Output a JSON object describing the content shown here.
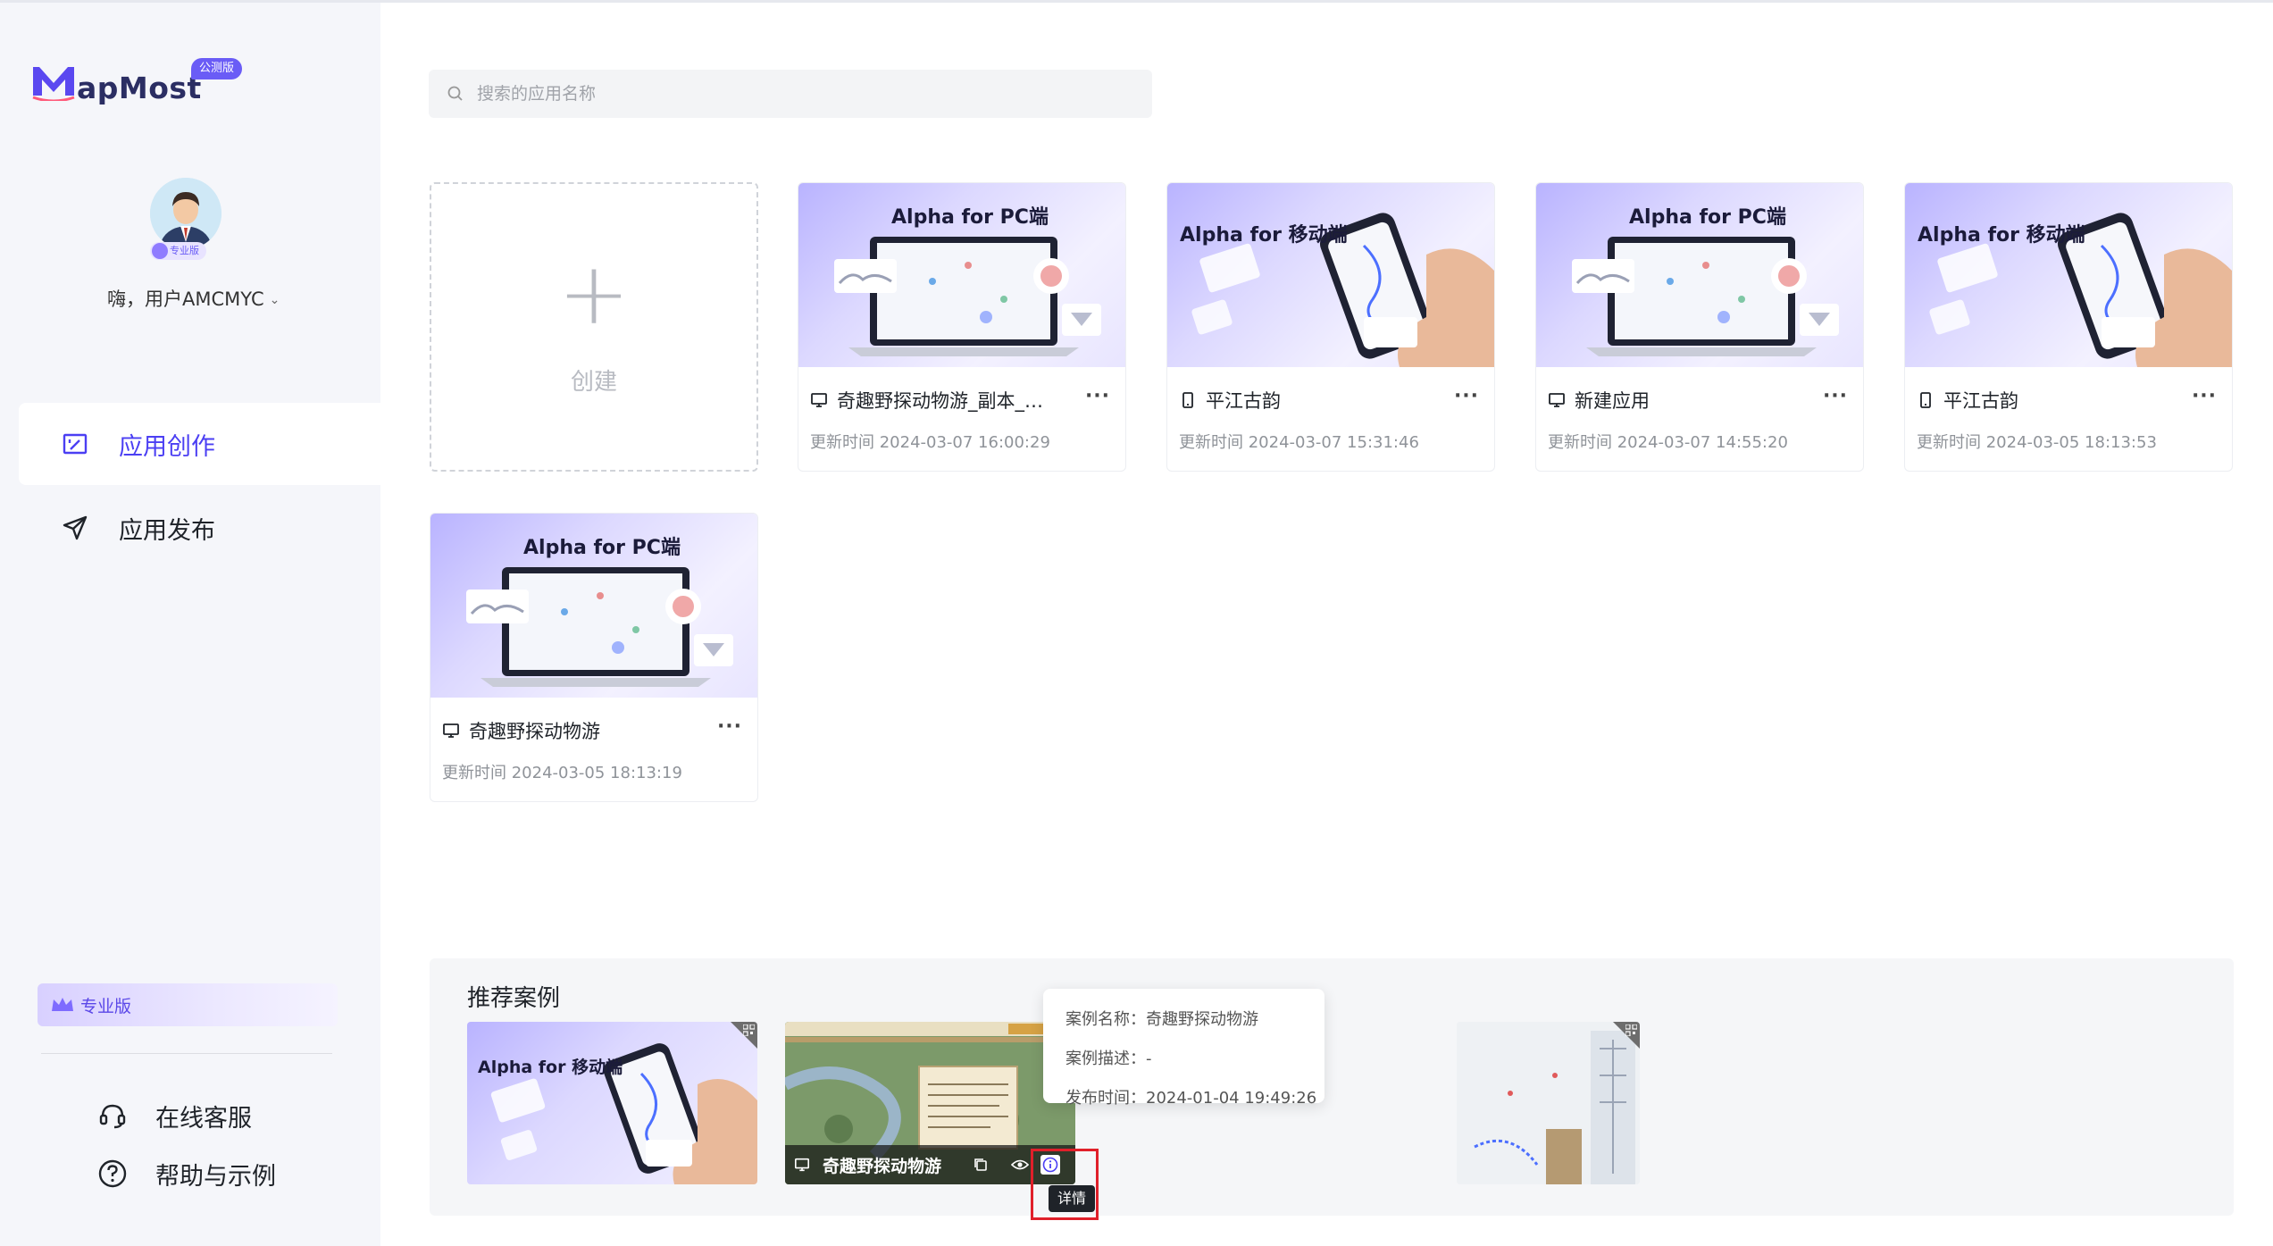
{
  "brand": {
    "logo_text": "apMost",
    "badge": "公测版"
  },
  "user": {
    "greeting": "嗨，用户AMCMYC",
    "plan_tag": "专业版"
  },
  "nav": {
    "create": "应用创作",
    "publish": "应用发布"
  },
  "sidebar_footer": {
    "pro_label": "专业版",
    "service": "在线客服",
    "help": "帮助与示例"
  },
  "search": {
    "placeholder": "搜索的应用名称"
  },
  "create_card": {
    "label": "创建"
  },
  "apps": [
    {
      "thumb_title": "Alpha for PC端",
      "type": "pc",
      "name": "奇趣野探动物游_副本_…",
      "time": "更新时间 2024-03-07 16:00:29"
    },
    {
      "thumb_title": "Alpha for 移动端",
      "type": "mobile",
      "name": "平江古韵",
      "time": "更新时间 2024-03-07 15:31:46"
    },
    {
      "thumb_title": "Alpha for PC端",
      "type": "pc",
      "name": "新建应用",
      "time": "更新时间 2024-03-07 14:55:20"
    },
    {
      "thumb_title": "Alpha for 移动端",
      "type": "mobile",
      "name": "平江古韵",
      "time": "更新时间 2024-03-05 18:13:53"
    },
    {
      "thumb_title": "Alpha for PC端",
      "type": "pc",
      "name": "奇趣野探动物游",
      "time": "更新时间 2024-03-05 18:13:19"
    }
  ],
  "more_label": "···",
  "recommend": {
    "title": "推荐案例",
    "cases": [
      {
        "thumb_title": "Alpha for 移动端"
      },
      {
        "name": "奇趣野探动物游"
      },
      {
        "name": ""
      }
    ],
    "popover": {
      "name_label": "案例名称：",
      "name_value": "奇趣野探动物游",
      "desc_label": "案例描述：",
      "desc_value": "-",
      "time_label": "发布时间：",
      "time_value": "2024-01-04 19:49:26"
    },
    "tooltip": "详情"
  },
  "colors": {
    "accent": "#4b3ff3",
    "sidebar_bg": "#f5f6fa",
    "highlight": "#e0202a"
  }
}
